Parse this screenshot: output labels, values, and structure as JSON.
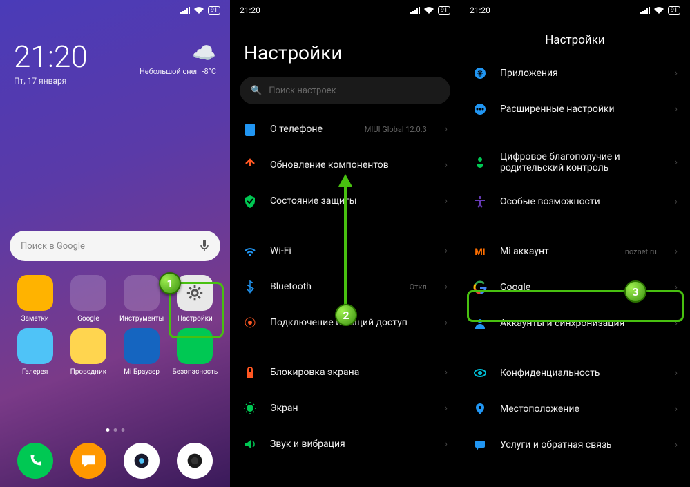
{
  "status": {
    "time": "21:20",
    "battery": "91"
  },
  "screen1": {
    "clock": "21:20",
    "date": "Пт, 17 января",
    "weather_desc": "Небольшой снег",
    "weather_temp": "-8°C",
    "search_placeholder": "Поиск в Google",
    "apps_row1": [
      {
        "label": "Заметки",
        "bg": "#ffb300"
      },
      {
        "label": "Google",
        "bg": "folder"
      },
      {
        "label": "Инструменты",
        "bg": "folder"
      },
      {
        "label": "Настройки",
        "bg": "#e8e8e8"
      }
    ],
    "apps_row2": [
      {
        "label": "Галерея",
        "bg": "#4fc3f7"
      },
      {
        "label": "Проводник",
        "bg": "#ffd54f"
      },
      {
        "label": "Mi Браузер",
        "bg": "#1565c0"
      },
      {
        "label": "Безопасность",
        "bg": "#00c853"
      }
    ],
    "dock": [
      {
        "name": "phone",
        "bg": "#00c853"
      },
      {
        "name": "messages",
        "bg": "#ff9800"
      },
      {
        "name": "browser",
        "bg": "#fff"
      },
      {
        "name": "camera",
        "bg": "#fff"
      }
    ]
  },
  "screen2": {
    "title": "Настройки",
    "search_placeholder": "Поиск настроек",
    "items": [
      {
        "icon": "phone",
        "color": "#2196f3",
        "label": "О телефоне",
        "sub": "MIUI Global 12.0.3"
      },
      {
        "icon": "update",
        "color": "#ff5722",
        "label": "Обновление компонентов"
      },
      {
        "icon": "shield",
        "color": "#00c853",
        "label": "Состояние защиты"
      },
      {
        "gap": true
      },
      {
        "icon": "wifi",
        "color": "#2196f3",
        "label": "Wi-Fi",
        "sub": ""
      },
      {
        "icon": "bluetooth",
        "color": "#2196f3",
        "label": "Bluetooth",
        "sub": "Откл"
      },
      {
        "icon": "tether",
        "color": "#ff5722",
        "label": "Подключение и общий доступ"
      },
      {
        "gap": true
      },
      {
        "icon": "lock",
        "color": "#ff5722",
        "label": "Блокировка экрана"
      },
      {
        "icon": "display",
        "color": "#00c853",
        "label": "Экран"
      },
      {
        "icon": "sound",
        "color": "#00c853",
        "label": "Звук и вибрация"
      }
    ]
  },
  "screen3": {
    "title": "Настройки",
    "items": [
      {
        "icon": "apps",
        "color": "#2196f3",
        "label": "Приложения"
      },
      {
        "icon": "more",
        "color": "#2196f3",
        "label": "Расширенные настройки"
      },
      {
        "gap": true
      },
      {
        "icon": "wellbeing",
        "color": "#00c853",
        "label": "Цифровое благополучие и родительский контроль"
      },
      {
        "icon": "accessibility",
        "color": "#673ab7",
        "label": "Особые возможности"
      },
      {
        "gap": true
      },
      {
        "icon": "mi",
        "color": "#ff6f00",
        "label": "Mi аккаунт",
        "sub": "noznet.ru"
      },
      {
        "icon": "google",
        "color": "",
        "label": "Google"
      },
      {
        "icon": "accounts",
        "color": "#2196f3",
        "label": "Аккаунты и синхронизация"
      },
      {
        "gap": true
      },
      {
        "icon": "privacy",
        "color": "#00bcd4",
        "label": "Конфиденциальность"
      },
      {
        "icon": "location",
        "color": "#2196f3",
        "label": "Местоположение"
      },
      {
        "icon": "feedback",
        "color": "#2196f3",
        "label": "Услуги и обратная связь"
      }
    ]
  },
  "badges": {
    "b1": "1",
    "b2": "2",
    "b3": "3"
  }
}
